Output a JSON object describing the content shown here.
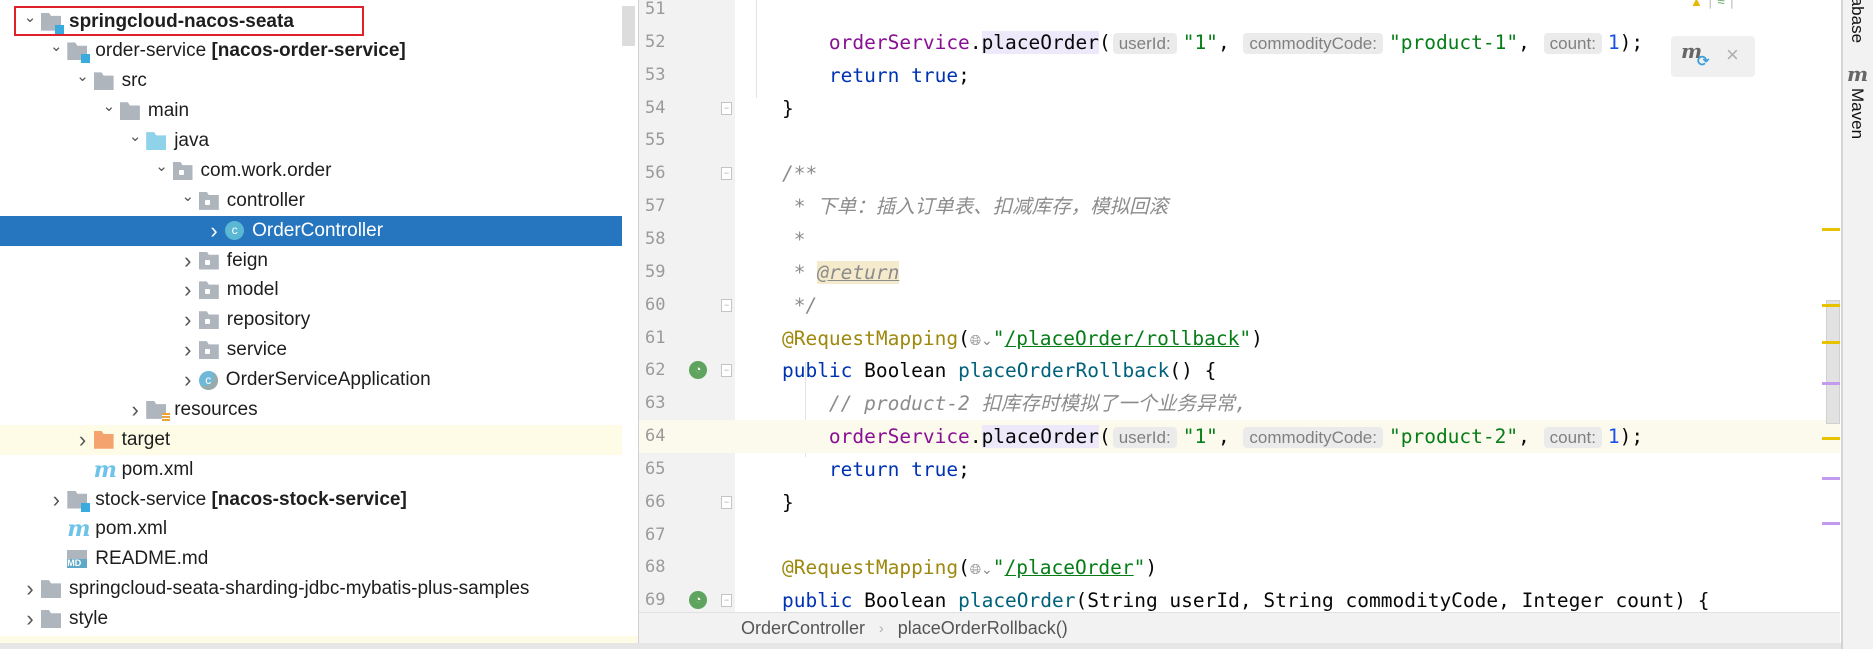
{
  "project_tree": {
    "rows": [
      {
        "label": "springcloud-nacos-seata",
        "suffix": "",
        "level": 0,
        "chevron": "down",
        "icon": "module-folder",
        "bold": true,
        "highlight": "red-box"
      },
      {
        "label": "order-service ",
        "suffix": "[nacos-order-service]",
        "level": 1,
        "chevron": "down",
        "icon": "module-folder"
      },
      {
        "label": "src",
        "level": 2,
        "chevron": "down",
        "icon": "folder"
      },
      {
        "label": "main",
        "level": 3,
        "chevron": "down",
        "icon": "folder"
      },
      {
        "label": "java",
        "level": 4,
        "chevron": "down",
        "icon": "source-folder"
      },
      {
        "label": "com.work.order",
        "level": 5,
        "chevron": "down",
        "icon": "package"
      },
      {
        "label": "controller",
        "level": 6,
        "chevron": "down",
        "icon": "package"
      },
      {
        "label": "OrderController",
        "level": 7,
        "chevron": "right",
        "icon": "class",
        "selected": true
      },
      {
        "label": "feign",
        "level": 6,
        "chevron": "right",
        "icon": "package"
      },
      {
        "label": "model",
        "level": 6,
        "chevron": "right",
        "icon": "package"
      },
      {
        "label": "repository",
        "level": 6,
        "chevron": "right",
        "icon": "package"
      },
      {
        "label": "service",
        "level": 6,
        "chevron": "right",
        "icon": "package"
      },
      {
        "label": "OrderServiceApplication",
        "level": 6,
        "chevron": "right",
        "icon": "spring-boot-class"
      },
      {
        "label": "resources",
        "level": 4,
        "chevron": "right",
        "icon": "resources-folder"
      },
      {
        "label": "target",
        "level": 2,
        "chevron": "right",
        "icon": "excluded-folder",
        "row_highlight": true
      },
      {
        "label": "pom.xml",
        "level": 2,
        "chevron": "",
        "icon": "maven"
      },
      {
        "label": "stock-service ",
        "suffix": "[nacos-stock-service]",
        "level": 1,
        "chevron": "right",
        "icon": "module-folder"
      },
      {
        "label": "pom.xml",
        "level": 1,
        "chevron": "",
        "icon": "maven"
      },
      {
        "label": "README.md",
        "level": 1,
        "chevron": "",
        "icon": "markdown"
      },
      {
        "label": "springcloud-seata-sharding-jdbc-mybatis-plus-samples",
        "level": 0,
        "chevron": "right",
        "icon": "folder"
      },
      {
        "label": "style",
        "level": 0,
        "chevron": "right",
        "icon": "folder"
      }
    ]
  },
  "editor": {
    "current_line": 64,
    "lines": [
      {
        "n": 51,
        "tokens": []
      },
      {
        "n": 52,
        "tokens": [
          {
            "t": "        "
          },
          {
            "t": "orderService",
            "k": "field"
          },
          {
            "t": "."
          },
          {
            "t": "placeOrder",
            "k": "mhl"
          },
          {
            "t": "("
          },
          {
            "t": "userId:",
            "k": "hint"
          },
          {
            "t": "\"1\"",
            "k": "str"
          },
          {
            "t": ", "
          },
          {
            "t": "commodityCode:",
            "k": "hint"
          },
          {
            "t": "\"product-1\"",
            "k": "str"
          },
          {
            "t": ", "
          },
          {
            "t": "count:",
            "k": "hint"
          },
          {
            "t": "1",
            "k": "num"
          },
          {
            "t": ");"
          }
        ]
      },
      {
        "n": 53,
        "tokens": [
          {
            "t": "        "
          },
          {
            "t": "return",
            "k": "kw"
          },
          {
            "t": " "
          },
          {
            "t": "true",
            "k": "kw"
          },
          {
            "t": ";"
          }
        ]
      },
      {
        "n": 54,
        "fold": "end",
        "tokens": [
          {
            "t": "    }"
          }
        ]
      },
      {
        "n": 55,
        "tokens": []
      },
      {
        "n": 56,
        "fold": "start",
        "tokens": [
          {
            "t": "    /**",
            "k": "cm"
          }
        ]
      },
      {
        "n": 57,
        "tokens": [
          {
            "t": "     * 下单：插入订单表、扣减库存，模拟回滚",
            "k": "cm"
          }
        ]
      },
      {
        "n": 58,
        "tokens": [
          {
            "t": "     *",
            "k": "cm"
          }
        ]
      },
      {
        "n": 59,
        "tokens": [
          {
            "t": "     * ",
            "k": "cm"
          },
          {
            "t": "@return",
            "k": "tag"
          }
        ]
      },
      {
        "n": 60,
        "fold": "end",
        "tokens": [
          {
            "t": "     */",
            "k": "cm"
          }
        ]
      },
      {
        "n": 61,
        "tokens": [
          {
            "t": "    "
          },
          {
            "t": "@RequestMapping",
            "k": "ann"
          },
          {
            "t": "("
          },
          {
            "t": "🌐︎⌄",
            "k": "globe"
          },
          {
            "t": "\"",
            "k": "str"
          },
          {
            "t": "/placeOrder/rollback",
            "k": "link"
          },
          {
            "t": "\"",
            "k": "str"
          },
          {
            "t": ")"
          }
        ]
      },
      {
        "n": 62,
        "run": true,
        "fold": "start",
        "tokens": [
          {
            "t": "    "
          },
          {
            "t": "public",
            "k": "kw"
          },
          {
            "t": " Boolean "
          },
          {
            "t": "placeOrderRollback",
            "k": "method"
          },
          {
            "t": "() {"
          }
        ]
      },
      {
        "n": 63,
        "tokens": [
          {
            "t": "        "
          },
          {
            "t": "// product-2 扣库存时模拟了一个业务异常,",
            "k": "cm"
          }
        ]
      },
      {
        "n": 64,
        "tokens": [
          {
            "t": "        "
          },
          {
            "t": "orderService",
            "k": "field"
          },
          {
            "t": "."
          },
          {
            "t": "placeOrder",
            "k": "mhl"
          },
          {
            "t": "("
          },
          {
            "t": "userId:",
            "k": "hint"
          },
          {
            "t": "\"1\"",
            "k": "str"
          },
          {
            "t": ", "
          },
          {
            "t": "commodityCode:",
            "k": "hint"
          },
          {
            "t": "\"product-2\"",
            "k": "str"
          },
          {
            "t": ", "
          },
          {
            "t": "count:",
            "k": "hint"
          },
          {
            "t": "1",
            "k": "num"
          },
          {
            "t": ");"
          }
        ]
      },
      {
        "n": 65,
        "tokens": [
          {
            "t": "        "
          },
          {
            "t": "return",
            "k": "kw"
          },
          {
            "t": " "
          },
          {
            "t": "true",
            "k": "kw"
          },
          {
            "t": ";"
          }
        ]
      },
      {
        "n": 66,
        "fold": "end",
        "tokens": [
          {
            "t": "    }"
          }
        ]
      },
      {
        "n": 67,
        "tokens": []
      },
      {
        "n": 68,
        "tokens": [
          {
            "t": "    "
          },
          {
            "t": "@RequestMapping",
            "k": "ann"
          },
          {
            "t": "("
          },
          {
            "t": "🌐︎⌄",
            "k": "globe"
          },
          {
            "t": "\"",
            "k": "str"
          },
          {
            "t": "/placeOrder",
            "k": "link"
          },
          {
            "t": "\"",
            "k": "str"
          },
          {
            "t": ")"
          }
        ]
      },
      {
        "n": 69,
        "run": true,
        "fold": "start",
        "tokens": [
          {
            "t": "    "
          },
          {
            "t": "public",
            "k": "kw"
          },
          {
            "t": " Boolean "
          },
          {
            "t": "placeOrder",
            "k": "method"
          },
          {
            "t": "(String userId, String commodityCode, Integer count) {"
          }
        ]
      }
    ]
  },
  "breadcrumb": {
    "items": [
      "OrderController",
      "placeOrderRollback()"
    ],
    "separator": "›"
  },
  "right_toolstrip": {
    "database_label": "tabase",
    "maven_label": "Maven"
  },
  "maven_popup": {
    "icon": "maven-reload-icon",
    "close": "×"
  },
  "colors": {
    "selection": "#2675bf",
    "red_box": "#e0202a",
    "current_line": "#fcfaed",
    "warning_mark": "#e6c200",
    "info_mark": "#c39bee"
  }
}
